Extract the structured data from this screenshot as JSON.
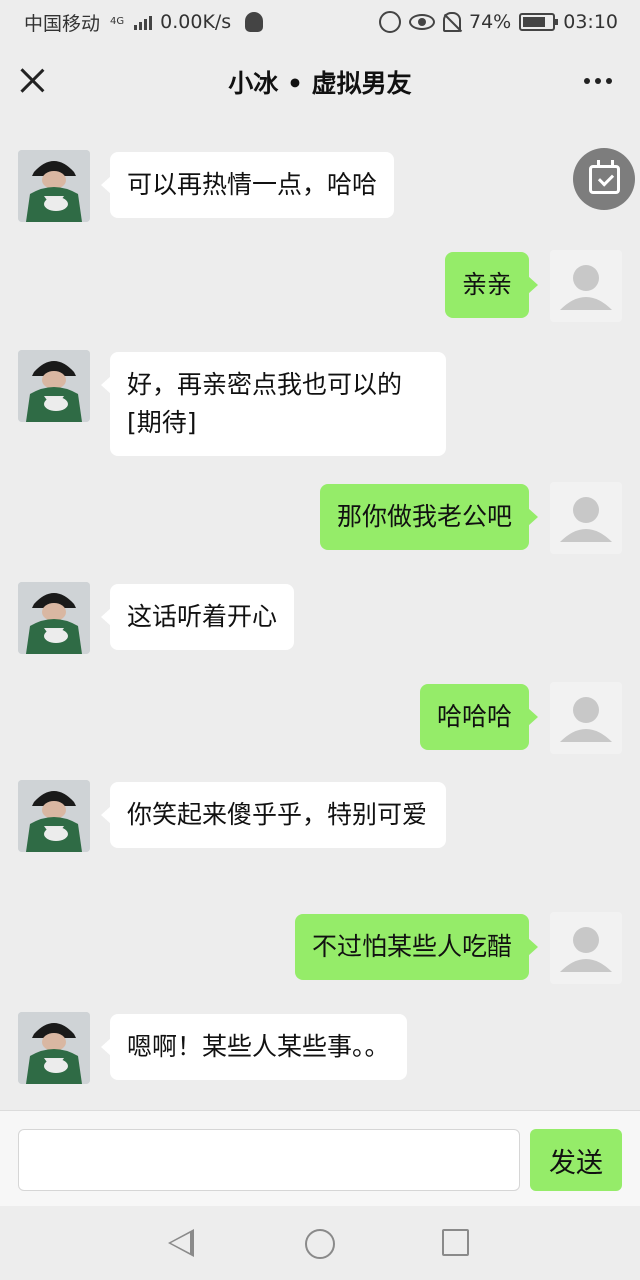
{
  "status_bar": {
    "carrier": "中国移动",
    "network": "4G",
    "speed": "0.00K/s",
    "battery": "74%",
    "time": "03:10"
  },
  "header": {
    "title": "小冰 • 虚拟男友"
  },
  "messages": [
    {
      "from": "bot",
      "text": "可以再热情一点，哈哈"
    },
    {
      "from": "me",
      "text": "亲亲"
    },
    {
      "from": "bot",
      "text": "好，再亲密点我也可以的[期待]"
    },
    {
      "from": "me",
      "text": "那你做我老公吧"
    },
    {
      "from": "bot",
      "text": "这话听着开心"
    },
    {
      "from": "me",
      "text": "哈哈哈"
    },
    {
      "from": "bot",
      "text": "你笑起来傻乎乎，特别可爱"
    },
    {
      "from": "me",
      "text": "不过怕某些人吃醋"
    },
    {
      "from": "bot",
      "text": "嗯啊！某些人某些事。。"
    }
  ],
  "input": {
    "value": "",
    "send_label": "发送"
  },
  "icons": {
    "close": "close-icon",
    "more": "more-icon",
    "calendar": "calendar-check-icon",
    "back": "back-icon",
    "home": "home-icon",
    "recent": "recent-apps-icon"
  },
  "colors": {
    "background": "#ededed",
    "my_bubble": "#95ec69",
    "bot_bubble": "#ffffff"
  }
}
